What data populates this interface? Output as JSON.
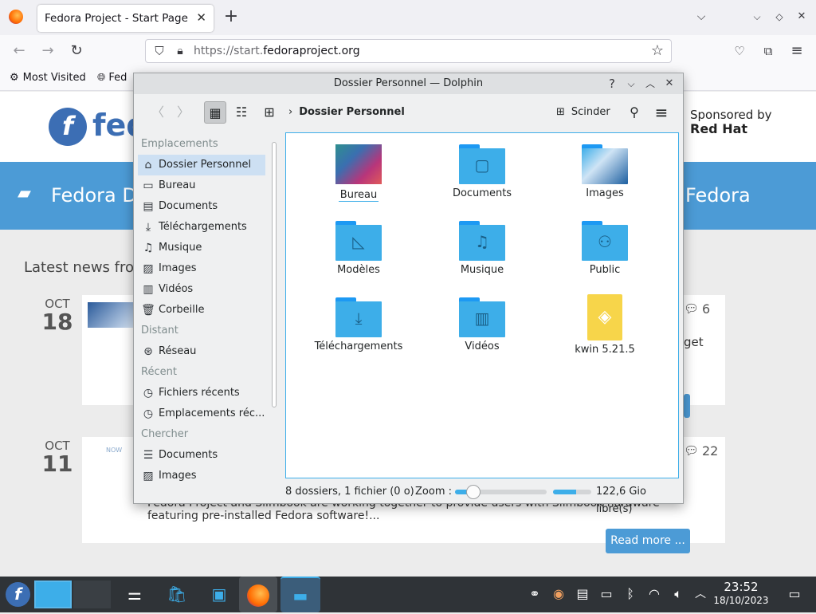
{
  "browser": {
    "tab_title": "Fedora Project - Start Page",
    "url_prefix": "https://start.",
    "url_domain": "fedoraproject.org",
    "bookmarks": [
      "Most Visited",
      "Fed"
    ]
  },
  "webpage": {
    "logo_text": "fed",
    "sponsor_line1": "Sponsored by",
    "sponsor_line2": "Red Hat",
    "band_left": "Fedora D",
    "band_right": "Fedora",
    "news_title": "Latest news from",
    "posts": [
      {
        "month": "OCT",
        "day": "18",
        "comments": "6",
        "snippet": "get"
      },
      {
        "month": "OCT",
        "day": "11",
        "comments": "22",
        "snippet": "Fedora Project and Slimbook are working together to provide users with Slimbook hardware featuring pre-installed Fedora software!..."
      }
    ],
    "read_more": "Read more ..."
  },
  "dolphin": {
    "title": "Dossier Personnel — Dolphin",
    "breadcrumb": "Dossier Personnel",
    "split_label": "Scinder",
    "places": {
      "section1": "Emplacements",
      "items1": [
        "Dossier Personnel",
        "Bureau",
        "Documents",
        "Téléchargements",
        "Musique",
        "Images",
        "Vidéos",
        "Corbeille"
      ],
      "section2": "Distant",
      "items2": [
        "Réseau"
      ],
      "section3": "Récent",
      "items3": [
        "Fichiers récents",
        "Emplacements réc..."
      ],
      "section4": "Chercher",
      "items4": [
        "Documents",
        "Images"
      ]
    },
    "files": [
      "Bureau",
      "Documents",
      "Images",
      "Modèles",
      "Musique",
      "Public",
      "Téléchargements",
      "Vidéos",
      "kwin 5.21.5"
    ],
    "status": "8 dossiers, 1 fichier (0 o)",
    "zoom_label": "Zoom :",
    "zoom_level": 0.2,
    "free_space": "122,6 Gio libre(s)",
    "free_space_fraction": 0.6
  },
  "taskbar": {
    "time": "23:52",
    "date": "18/10/2023"
  },
  "colors": {
    "fedora_blue": "#3c6eb4",
    "band_blue": "#4c9bd6",
    "folder_blue": "#3daee9",
    "taskbar": "#2f3337"
  }
}
